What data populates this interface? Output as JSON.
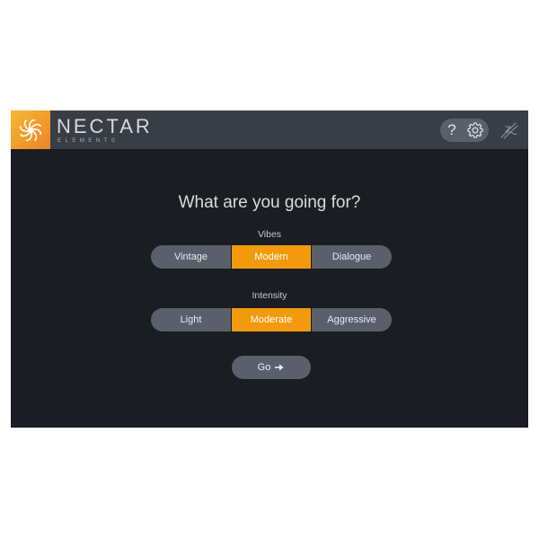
{
  "header": {
    "brand_name": "NECTAR",
    "brand_subtitle": "ELEMENTS",
    "help_label": "?",
    "logo_icon": "flower-logo-icon",
    "settings_icon": "gear-icon",
    "vendor_icon": "izotope-mark-icon"
  },
  "main": {
    "question": "What are you going for?",
    "vibes": {
      "label": "Vibes",
      "options": [
        "Vintage",
        "Modern",
        "Dialogue"
      ],
      "selected": "Modern"
    },
    "intensity": {
      "label": "Intensity",
      "options": [
        "Light",
        "Moderate",
        "Aggressive"
      ],
      "selected": "Moderate"
    },
    "go": {
      "label": "Go",
      "icon": "arrow-right-icon"
    }
  },
  "colors": {
    "accent": "#f29a0d",
    "panel": "#1a1d21",
    "header": "#393e46",
    "button": "#5a6069"
  }
}
